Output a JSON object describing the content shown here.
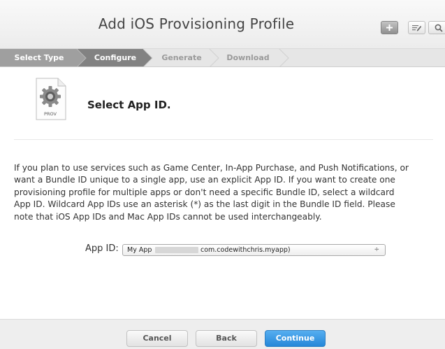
{
  "header": {
    "title": "Add iOS Provisioning Profile",
    "toolbar": [
      {
        "icon": "plus-icon"
      },
      {
        "icon": "edit-icon"
      },
      {
        "icon": "search-icon"
      }
    ]
  },
  "steps": [
    {
      "label": "Select Type",
      "state": "done"
    },
    {
      "label": "Configure",
      "state": "current"
    },
    {
      "label": "Generate",
      "state": "pending"
    },
    {
      "label": "Download",
      "state": "pending"
    }
  ],
  "content": {
    "icon_label": "PROV",
    "section_title": "Select App ID.",
    "description": "If you plan to use services such as Game Center, In-App Purchase, and Push Notifications, or want a Bundle ID unique to a single app, use an explicit App ID. If you want to create one provisioning profile for multiple apps or don't need a specific Bundle ID, select a wildcard App ID. Wildcard App IDs use an asterisk (*) as the last digit in the Bundle ID field. Please note that iOS App IDs and Mac App IDs cannot be used interchangeably.",
    "app_id": {
      "label": "App ID:",
      "selected_prefix": "My App",
      "selected_suffix": "com.codewithchris.myapp)",
      "arrow": "÷"
    }
  },
  "footer": {
    "cancel_label": "Cancel",
    "back_label": "Back",
    "continue_label": "Continue"
  },
  "colors": {
    "step_done": "#9f9f9f",
    "step_current": "#828282",
    "step_pending": "#e6e6e6",
    "primary_button": "#2587d8"
  }
}
